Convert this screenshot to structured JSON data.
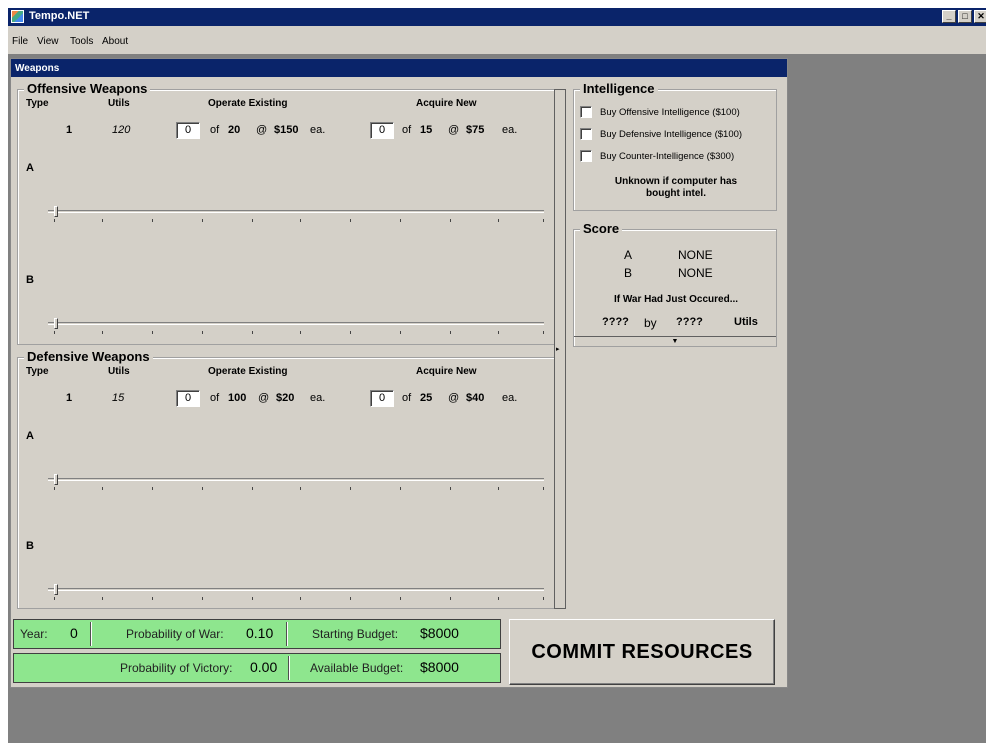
{
  "window": {
    "title": "Tempo.NET"
  },
  "menu": [
    "File",
    "View",
    "Tools",
    "About"
  ],
  "child": {
    "title": "Weapons"
  },
  "headers": {
    "type": "Type",
    "utils": "Utils",
    "operate": "Operate Existing",
    "acquire": "Acquire New"
  },
  "offensive": {
    "title": "Offensive Weapons",
    "type": "1",
    "utils": "120",
    "operate_value": "0",
    "operate_of": "of",
    "operate_max": "20",
    "operate_at": "@",
    "operate_price": "$150",
    "operate_ea": "ea.",
    "acquire_value": "0",
    "acquire_of": "of",
    "acquire_max": "15",
    "acquire_at": "@",
    "acquire_price": "$75",
    "acquire_ea": "ea.",
    "row_a": "A",
    "row_b": "B"
  },
  "defensive": {
    "title": "Defensive Weapons",
    "type": "1",
    "utils": "15",
    "operate_value": "0",
    "operate_of": "of",
    "operate_max": "100",
    "operate_at": "@",
    "operate_price": "$20",
    "operate_ea": "ea.",
    "acquire_value": "0",
    "acquire_of": "of",
    "acquire_max": "25",
    "acquire_at": "@",
    "acquire_price": "$40",
    "acquire_ea": "ea.",
    "row_a": "A",
    "row_b": "B"
  },
  "intelligence": {
    "title": "Intelligence",
    "items": [
      "Buy Offensive Intelligence ($100)",
      "Buy Defensive Intelligence ($100)",
      "Buy Counter-Intelligence ($300)"
    ],
    "note_line1": "Unknown if computer has",
    "note_line2": "bought intel."
  },
  "score": {
    "title": "Score",
    "a_label": "A",
    "a_value": "NONE",
    "b_label": "B",
    "b_value": "NONE",
    "war_text": "If War Had Just Occured...",
    "left": "????",
    "by": "by",
    "right": "????",
    "unit": "Utils"
  },
  "status": {
    "year_label": "Year:",
    "year_value": "0",
    "prob_war_label": "Probability of War:",
    "prob_war_value": "0.10",
    "start_budget_label": "Starting Budget:",
    "start_budget_value": "$8000",
    "prob_victory_label": "Probability of Victory:",
    "prob_victory_value": "0.00",
    "avail_budget_label": "Available Budget:",
    "avail_budget_value": "$8000"
  },
  "commit_label": "COMMIT RESOURCES",
  "colors": {
    "titlebar": "#0a246a",
    "status_green": "#8ee68e",
    "panel": "#d4d0c8",
    "workspace": "#808080"
  }
}
